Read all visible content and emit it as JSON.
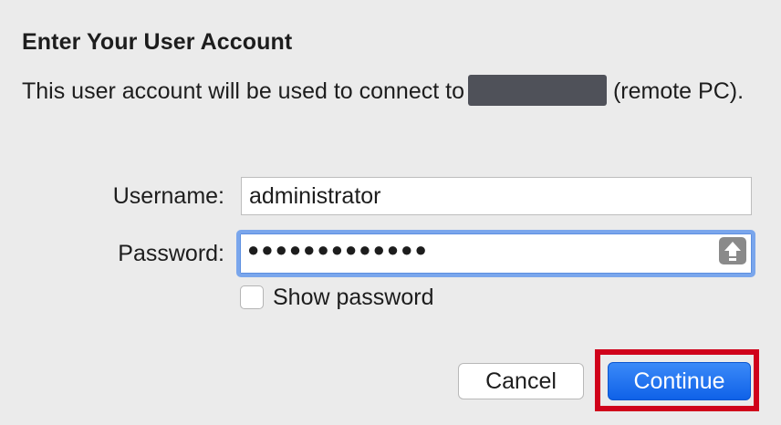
{
  "dialog": {
    "title": "Enter Your User Account",
    "description_prefix": "This user account will be used to connect to",
    "description_suffix": "(remote PC)."
  },
  "form": {
    "username_label": "Username:",
    "username_value": "administrator",
    "password_label": "Password:",
    "password_masked": "●●●●●●●●●●●●●",
    "caps_lock_icon": "caps-lock-icon",
    "show_password_label": "Show password",
    "show_password_checked": false
  },
  "buttons": {
    "cancel": "Cancel",
    "continue": "Continue"
  },
  "colors": {
    "primary_button": "#1a6df3",
    "focus_ring": "#7aa6ec",
    "highlight_box": "#d0021b"
  }
}
